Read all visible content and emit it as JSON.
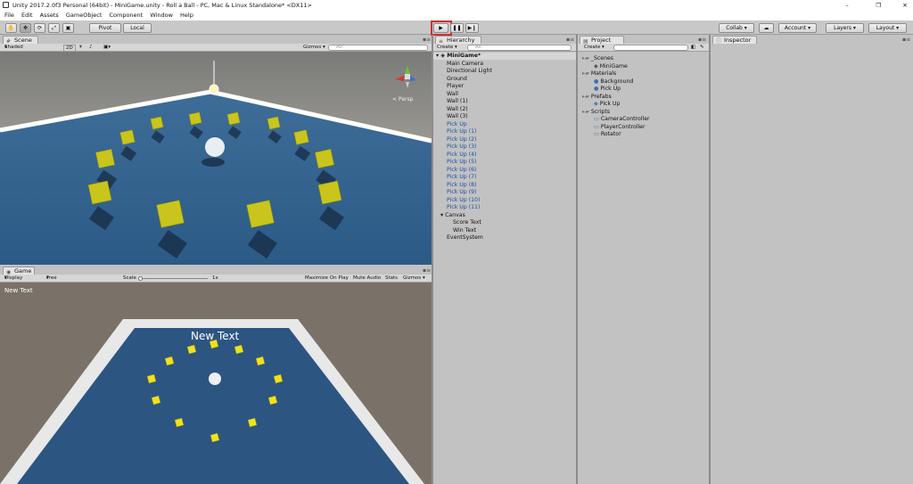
{
  "window": {
    "title": "Unity 2017.2.0f3 Personal (64bit) - MiniGame.unity - Roll a Ball - PC, Mac & Linux Standalone* <DX11>",
    "controls": [
      "–",
      "❐",
      "✕"
    ]
  },
  "menu": [
    "File",
    "Edit",
    "Assets",
    "GameObject",
    "Component",
    "Window",
    "Help"
  ],
  "toolbar": {
    "pivot": "Pivot",
    "local": "Local",
    "collab": "Collab ▾",
    "account": "Account",
    "layers": "Layers",
    "layout": "Layout"
  },
  "scene": {
    "tab": "Scene",
    "shading": "Shaded",
    "mode2d": "2D",
    "gizmos": "Gizmos ▾",
    "search_placeholder": "All",
    "persp": "< Persp"
  },
  "game": {
    "tab": "Game",
    "display": "Display 1",
    "aspect": "Free Aspect",
    "scale_label": "Scale",
    "scale_value": "1x",
    "maximize": "Maximize On Play",
    "mute": "Mute Audio",
    "stats": "Stats",
    "gizmos": "Gizmos ▾",
    "corner_text": "New Text",
    "center_text": "New Text"
  },
  "hierarchy": {
    "tab": "Hierarchy",
    "create": "Create ▾",
    "search_placeholder": "All",
    "scene_name": "MiniGame*",
    "items": [
      {
        "label": "Main Camera",
        "prefab": false
      },
      {
        "label": "Directional Light",
        "prefab": false
      },
      {
        "label": "Ground",
        "prefab": false
      },
      {
        "label": "Player",
        "prefab": false
      },
      {
        "label": "Wall",
        "prefab": false
      },
      {
        "label": "Wall (1)",
        "prefab": false
      },
      {
        "label": "Wall (2)",
        "prefab": false
      },
      {
        "label": "Wall (3)",
        "prefab": false
      },
      {
        "label": "Pick Up",
        "prefab": true
      },
      {
        "label": "Pick Up (1)",
        "prefab": true
      },
      {
        "label": "Pick Up (2)",
        "prefab": true
      },
      {
        "label": "Pick Up (3)",
        "prefab": true
      },
      {
        "label": "Pick Up (4)",
        "prefab": true
      },
      {
        "label": "Pick Up (5)",
        "prefab": true
      },
      {
        "label": "Pick Up (6)",
        "prefab": true
      },
      {
        "label": "Pick Up (7)",
        "prefab": true
      },
      {
        "label": "Pick Up (8)",
        "prefab": true
      },
      {
        "label": "Pick Up (9)",
        "prefab": true
      },
      {
        "label": "Pick Up (10)",
        "prefab": true
      },
      {
        "label": "Pick Up (11)",
        "prefab": true
      }
    ],
    "canvas": "Canvas",
    "canvas_children": [
      "Score Text",
      "Win Text"
    ],
    "event_system": "EventSystem"
  },
  "project": {
    "tab": "Project",
    "create": "Create ▾",
    "tree": [
      {
        "label": "_Scenes",
        "kind": "folder",
        "depth": 0
      },
      {
        "label": "MiniGame",
        "kind": "scene",
        "depth": 1
      },
      {
        "label": "Materials",
        "kind": "folder",
        "depth": 0
      },
      {
        "label": "Background",
        "kind": "material",
        "depth": 1
      },
      {
        "label": "Pick Up",
        "kind": "material",
        "depth": 1
      },
      {
        "label": "Prefabs",
        "kind": "folder",
        "depth": 0
      },
      {
        "label": "Pick Up",
        "kind": "prefab",
        "depth": 1
      },
      {
        "label": "Scripts",
        "kind": "folder",
        "depth": 0
      },
      {
        "label": "CameraController",
        "kind": "script",
        "depth": 1
      },
      {
        "label": "PlayerController",
        "kind": "script",
        "depth": 1
      },
      {
        "label": "Rotator",
        "kind": "script",
        "depth": 1
      }
    ]
  },
  "inspector": {
    "tab": "Inspector"
  },
  "colors": {
    "play_highlight": "#d32f2f",
    "prefab_text": "#1c4fa0",
    "board_blue": "#2f5d8a",
    "pickup_yellow": "#c9c51c"
  }
}
